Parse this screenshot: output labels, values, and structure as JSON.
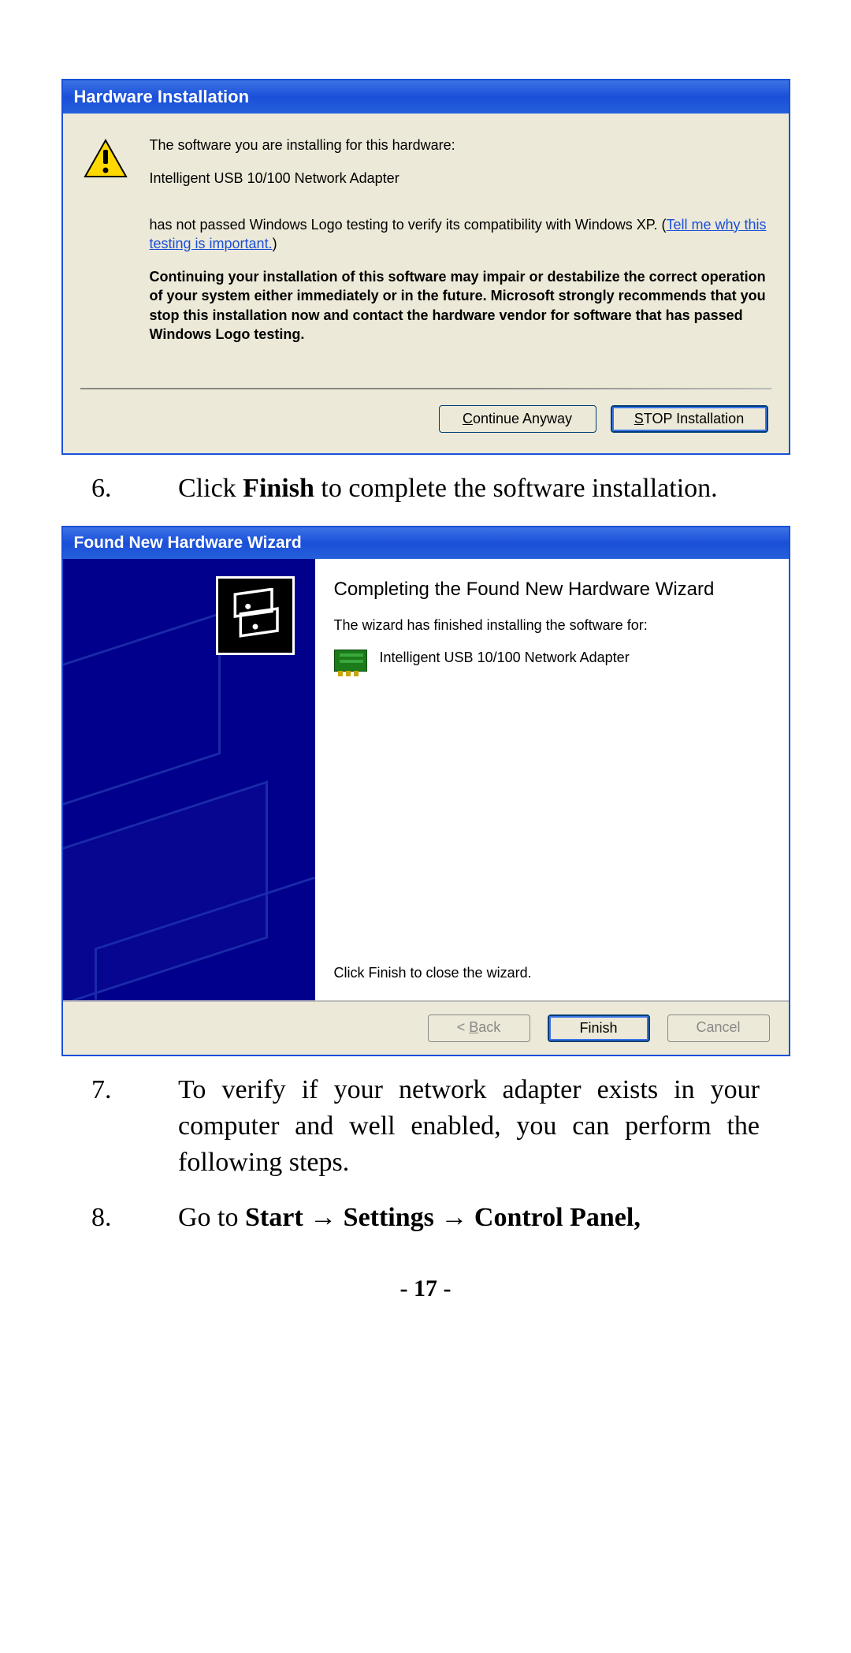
{
  "dialog1": {
    "title": "Hardware Installation",
    "line1": "The software you are installing for this hardware:",
    "device": "Intelligent USB 10/100 Network Adapter",
    "compat_prefix": "has not passed Windows Logo testing to verify its compatibility with Windows XP. (",
    "compat_link": "Tell me why this testing is important.",
    "compat_suffix": ")",
    "warning": "Continuing your installation of this software may impair or destabilize the correct operation of your system either immediately or in the future. Microsoft strongly recommends that you stop this installation now and contact the hardware vendor for software that has passed Windows Logo testing.",
    "continue_u": "C",
    "continue_rest": "ontinue Anyway",
    "stop_u": "S",
    "stop_rest": "TOP Installation"
  },
  "step6": {
    "num": "6.",
    "pre": "Click ",
    "bold": "Finish",
    "post": " to complete the software installation."
  },
  "dialog2": {
    "title": "Found New Hardware Wizard",
    "heading": "Completing the Found New Hardware Wizard",
    "sub": "The wizard has finished installing the software for:",
    "device": "Intelligent USB 10/100 Network Adapter",
    "close_hint": "Click Finish to close the wizard.",
    "back_lt": "< ",
    "back_u": "B",
    "back_rest": "ack",
    "finish": "Finish",
    "cancel": "Cancel"
  },
  "step7": {
    "num": "7.",
    "text": "To verify if your network adapter exists in your computer and well enabled, you can perform the following steps."
  },
  "step8": {
    "num": "8.",
    "pre": "Go to ",
    "b1": "Start",
    "arrow": " → ",
    "b2": "Settings",
    "b3": "Control Panel,"
  },
  "page_number": "- 17 -"
}
